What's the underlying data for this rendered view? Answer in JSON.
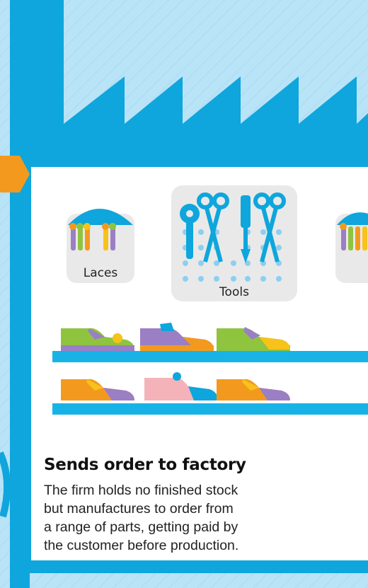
{
  "parts": {
    "laces_label": "Laces",
    "tools_label": "Tools"
  },
  "caption": {
    "heading": "Sends order to factory",
    "lines": [
      "The firm holds no finished stock",
      "but manufactures to order from",
      "a range of parts, getting paid by",
      "the customer before production."
    ]
  },
  "colors": {
    "factory_light": "#b9e3f7",
    "factory_blue": "#0ea6dc",
    "arrow_orange": "#f39a1e",
    "shelf": "#18b3e6",
    "card_grey": "#e9e9e9"
  }
}
